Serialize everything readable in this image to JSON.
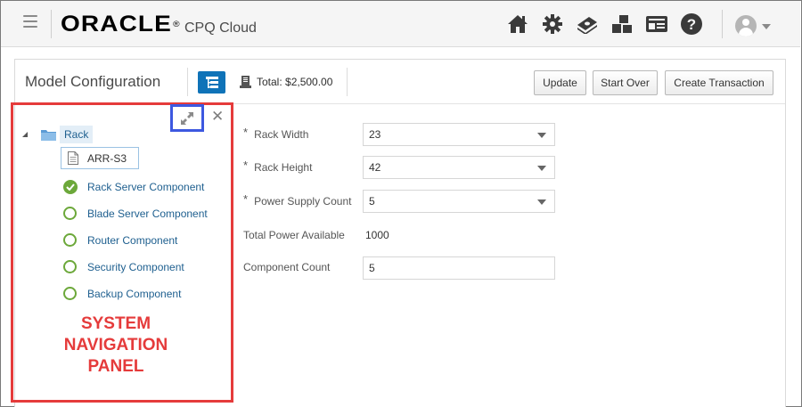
{
  "header": {
    "brand": "ORACLE",
    "brand_mark": "®",
    "product": "CPQ Cloud",
    "icons": [
      "home-icon",
      "gear-icon",
      "money-icon",
      "blocks-icon",
      "id-card-icon",
      "help-icon"
    ],
    "user_icon": "user-avatar-icon"
  },
  "toolbar": {
    "title": "Model Configuration",
    "total_label": "Total: $2,500.00",
    "buttons": {
      "update": "Update",
      "start_over": "Start Over",
      "create_transaction": "Create Transaction"
    }
  },
  "nav": {
    "root_label": "Rack",
    "model_label": "ARR-S3",
    "items": [
      {
        "label": "Rack Server Component",
        "status": "complete"
      },
      {
        "label": "Blade Server Component",
        "status": "incomplete"
      },
      {
        "label": "Router Component",
        "status": "incomplete"
      },
      {
        "label": "Security Component",
        "status": "incomplete"
      },
      {
        "label": "Backup Component",
        "status": "incomplete"
      }
    ],
    "annotation": [
      "SYSTEM",
      "NAVIGATION",
      "PANEL"
    ],
    "annotation_color": "#e53b3b",
    "expand_highlight_color": "#3d58e0"
  },
  "form": {
    "required_marker": "*",
    "rack_width": {
      "label": "Rack Width",
      "value": "23"
    },
    "rack_height": {
      "label": "Rack Height",
      "value": "42"
    },
    "power_supply_count": {
      "label": "Power Supply Count",
      "value": "5"
    },
    "total_power": {
      "label": "Total Power Available",
      "value": "1000"
    },
    "component_count": {
      "label": "Component Count",
      "value": "5"
    }
  },
  "colors": {
    "accent": "#0f73b8",
    "status_green": "#6ca83a",
    "link": "#1e5f8f"
  }
}
